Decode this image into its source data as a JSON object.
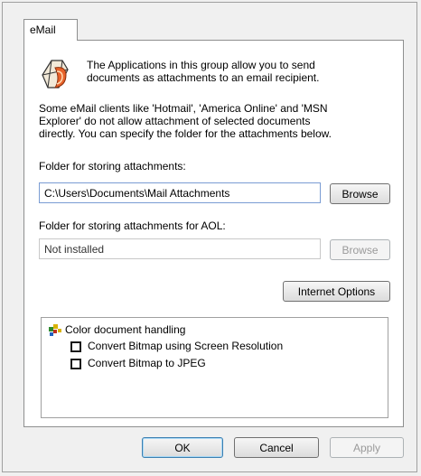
{
  "tab": {
    "label": "eMail"
  },
  "intro": {
    "line1": "The Applications in this group allow you to send",
    "line2": "documents as attachments to an email recipient."
  },
  "note": {
    "line1": "Some eMail clients like 'Hotmail', 'America Online' and 'MSN",
    "line2": "Explorer' do not allow attachment of selected documents",
    "line3": "directly. You can specify the folder for the attachments below."
  },
  "attachments": {
    "label": "Folder for storing attachments:",
    "value": "C:\\Users\\Documents\\Mail Attachments",
    "browse_label": "Browse"
  },
  "aol": {
    "label": "Folder for storing attachments for AOL:",
    "value": "Not installed",
    "browse_label": "Browse"
  },
  "internet_options_label": "Internet Options",
  "color_group": {
    "title": "Color document handling",
    "options": [
      {
        "label": "Convert Bitmap using Screen Resolution",
        "checked": false
      },
      {
        "label": "Convert Bitmap to JPEG",
        "checked": false
      }
    ]
  },
  "footer": {
    "ok_label": "OK",
    "cancel_label": "Cancel",
    "apply_label": "Apply"
  },
  "icons": {
    "app_icon": "email-application-icon",
    "group_icon": "color-document-icon"
  }
}
